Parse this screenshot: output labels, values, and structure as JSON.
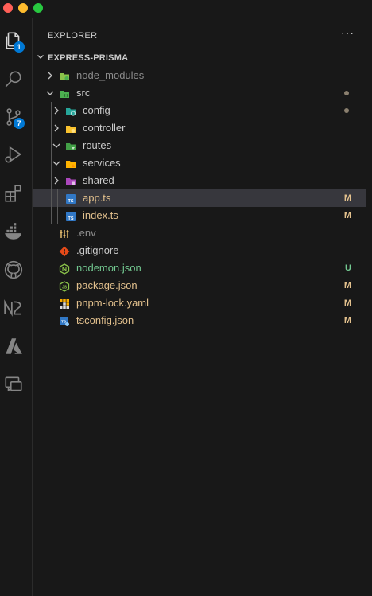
{
  "colors": {
    "modified": "#e2c08d",
    "untracked": "#73c991",
    "default_text": "#cccccc",
    "dim_text": "#8c8c8c",
    "badge": "#0078d4",
    "folder_green": "#8bc34a",
    "folder_teal": "#26a69a",
    "folder_yellow": "#f9c22e",
    "folder_purple": "#ab47bc"
  },
  "activity_bar": {
    "items": [
      {
        "icon": "files-icon",
        "badge": "1"
      },
      {
        "icon": "search-icon"
      },
      {
        "icon": "source-control-icon",
        "badge": "7"
      },
      {
        "icon": "run-debug-icon"
      },
      {
        "icon": "extensions-icon"
      },
      {
        "icon": "docker-icon"
      },
      {
        "icon": "github-icon"
      },
      {
        "icon": "nx-icon"
      },
      {
        "icon": "azure-icon"
      },
      {
        "icon": "remote-explorer-icon"
      }
    ]
  },
  "explorer": {
    "title": "EXPLORER",
    "more": "···",
    "project": "EXPRESS-PRISMA",
    "tree": [
      {
        "name": "node_modules",
        "kind": "folder",
        "expanded": false,
        "dim": true,
        "icon": "folder-node-icon"
      },
      {
        "name": "src",
        "kind": "folder",
        "expanded": true,
        "dot": true,
        "icon": "folder-src-icon"
      },
      {
        "name": "config",
        "kind": "folder",
        "expanded": false,
        "dot": true,
        "icon": "folder-config-icon"
      },
      {
        "name": "controller",
        "kind": "folder",
        "expanded": false,
        "icon": "folder-controller-icon"
      },
      {
        "name": "routes",
        "kind": "folder",
        "expanded": true,
        "icon": "folder-routes-icon"
      },
      {
        "name": "services",
        "kind": "folder",
        "expanded": true,
        "icon": "folder-services-icon"
      },
      {
        "name": "shared",
        "kind": "folder",
        "expanded": false,
        "icon": "folder-shared-icon"
      },
      {
        "name": "app.ts",
        "kind": "file",
        "status": "M",
        "icon": "typescript-icon",
        "selected": true
      },
      {
        "name": "index.ts",
        "kind": "file",
        "status": "M",
        "icon": "typescript-icon"
      },
      {
        "name": ".env",
        "kind": "file",
        "dim": true,
        "icon": "env-icon"
      },
      {
        "name": ".gitignore",
        "kind": "file",
        "icon": "git-icon"
      },
      {
        "name": "nodemon.json",
        "kind": "file",
        "status": "U",
        "icon": "nodemon-icon"
      },
      {
        "name": "package.json",
        "kind": "file",
        "status": "M",
        "icon": "nodejs-icon"
      },
      {
        "name": "pnpm-lock.yaml",
        "kind": "file",
        "status": "M",
        "icon": "pnpm-icon"
      },
      {
        "name": "tsconfig.json",
        "kind": "file",
        "status": "M",
        "icon": "tsconfig-icon"
      }
    ]
  }
}
